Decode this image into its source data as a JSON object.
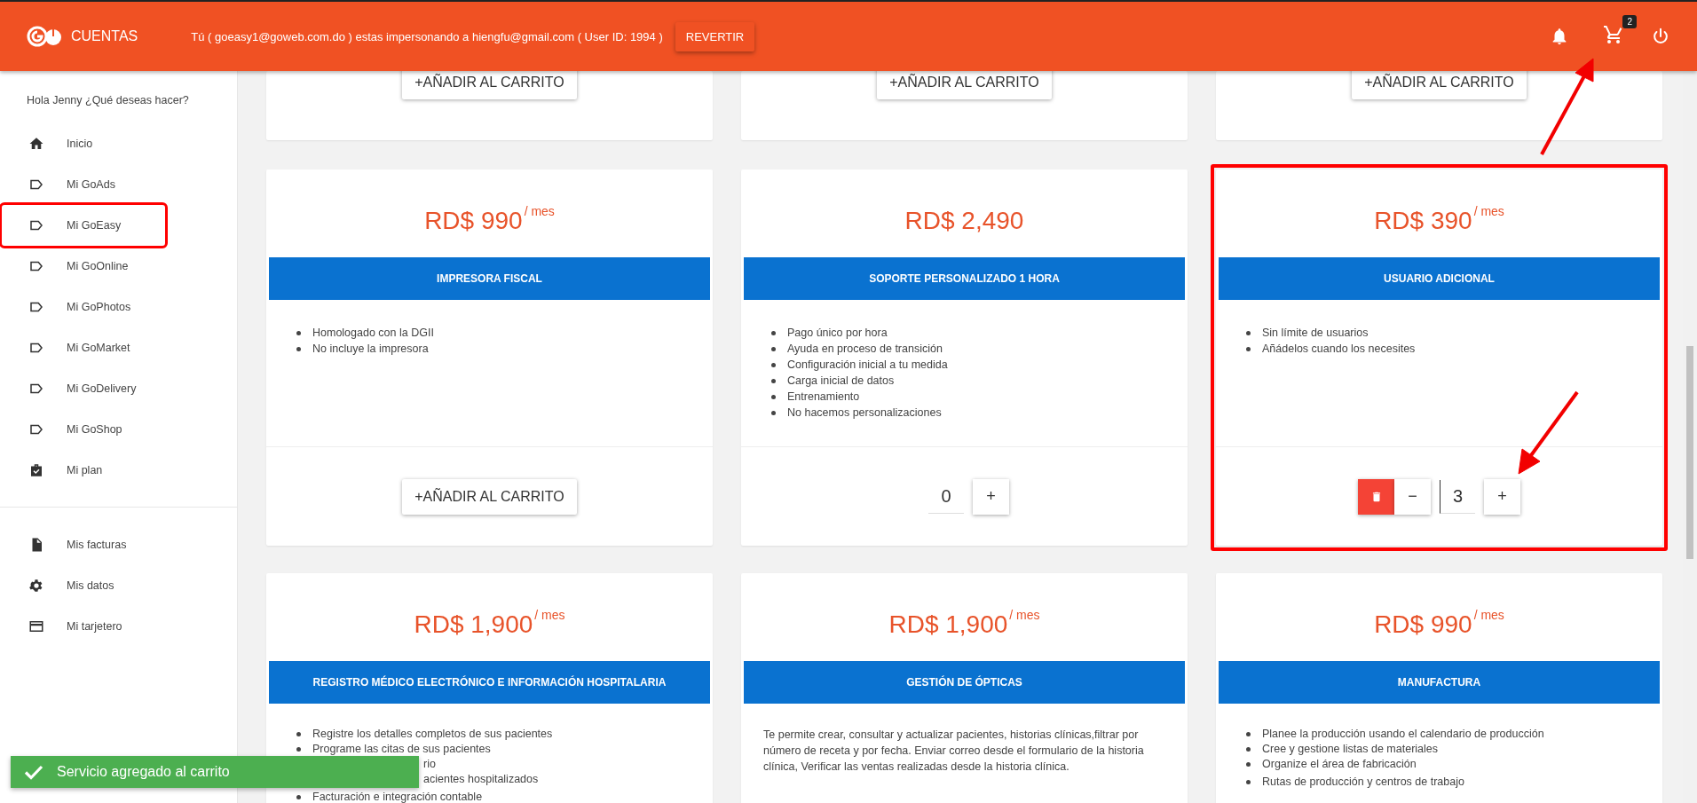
{
  "header": {
    "brand": "CUENTAS",
    "impersonation": "Tú ( goeasy1@goweb.com.do ) estas impersonando a hiengfu@gmail.com ( User ID: 1994 )",
    "revert_button": "REVERTIR",
    "cart_count": "2"
  },
  "sidebar": {
    "greeting": "Hola Jenny ¿Qué deseas hacer?",
    "groups": [
      [
        {
          "label": "Inicio",
          "highlighted": false
        },
        {
          "label": "Mi GoAds",
          "highlighted": false
        },
        {
          "label": "Mi GoEasy",
          "highlighted": true
        },
        {
          "label": "Mi GoOnline",
          "highlighted": false
        },
        {
          "label": "Mi GoPhotos",
          "highlighted": false
        },
        {
          "label": "Mi GoMarket",
          "highlighted": false
        },
        {
          "label": "Mi GoDelivery",
          "highlighted": false
        },
        {
          "label": "Mi GoShop",
          "highlighted": false
        },
        {
          "label": "Mi plan",
          "highlighted": false
        }
      ],
      [
        {
          "label": "Mis facturas",
          "highlighted": false
        },
        {
          "label": "Mis datos",
          "highlighted": false
        },
        {
          "label": "Mi tarjetero",
          "highlighted": false
        }
      ]
    ]
  },
  "top_row": [
    {
      "button": "+AÑADIR AL CARRITO"
    },
    {
      "button": "+AÑADIR AL CARRITO"
    },
    {
      "button": "+AÑADIR AL CARRITO"
    }
  ],
  "cards": [
    {
      "price": "RD$ 990",
      "period": "/ mes",
      "title": "IMPRESORA FISCAL",
      "highlighted": false,
      "features": [
        {
          "kind": "bullet",
          "text": "Homologado con la DGII"
        },
        {
          "kind": "bullet",
          "text": "No incluye la impresora"
        }
      ],
      "footer": {
        "kind": "add",
        "button": "+AÑADIR AL CARRITO"
      }
    },
    {
      "price": "RD$ 2,490",
      "title": "SOPORTE PERSONALIZADO 1 HORA",
      "highlighted": false,
      "features": [
        {
          "kind": "bullet",
          "text": "Pago único por hora"
        },
        {
          "kind": "bullet",
          "text": "Ayuda en proceso de transición"
        },
        {
          "kind": "bullet",
          "text": "Configuración inicial a tu medida"
        },
        {
          "kind": "bullet",
          "text": "Carga inicial de datos"
        },
        {
          "kind": "bullet",
          "text": "Entrenamiento"
        },
        {
          "kind": "bullet",
          "text": "No hacemos personalizaciones"
        }
      ],
      "footer": {
        "kind": "counter",
        "removable": false,
        "quantity": "0",
        "plus": "+"
      }
    },
    {
      "price": "RD$ 390",
      "period": "/ mes",
      "title": "USUARIO ADICIONAL",
      "highlighted": true,
      "features": [
        {
          "kind": "bullet",
          "text": "Sin límite de usuarios"
        },
        {
          "kind": "bullet",
          "text": "Añádelos cuando los necesites"
        }
      ],
      "footer": {
        "kind": "counter",
        "removable": true,
        "minus": "−",
        "quantity": "3",
        "plus": "+"
      }
    },
    {
      "price": "RD$ 1,900",
      "period": "/ mes",
      "title": "REGISTRO MÉDICO ELECTRÓNICO E INFORMACIÓN HOSPITALARIA",
      "highlighted": false,
      "features": [
        {
          "kind": "bullet",
          "text": "Registre los detalles completos de sus pacientes"
        },
        {
          "kind": "bullet",
          "text": "Programe las citas de sus pacientes"
        },
        {
          "kind": "fragment",
          "text": "rio"
        },
        {
          "kind": "fragment",
          "text": "acientes hospitalizados"
        },
        {
          "kind": "bullet",
          "text": "Facturación e integración contable"
        }
      ]
    },
    {
      "price": "RD$ 1,900",
      "period": "/ mes",
      "title": "GESTIÓN DE ÓPTICAS",
      "highlighted": false,
      "description": "Te permite crear, consultar y actualizar pacientes, historias clínicas,filtrar por número de receta y por fecha. Enviar correo desde el formulario de la historia clínica, Verificar las ventas realizadas desde la historia clínica."
    },
    {
      "price": "RD$ 990",
      "period": "/ mes",
      "title": "MANUFACTURA",
      "highlighted": false,
      "features": [
        {
          "kind": "bullet",
          "text": "Planee la producción usando el calendario de producción"
        },
        {
          "kind": "bullet",
          "text": "Cree y gestione listas de materiales"
        },
        {
          "kind": "bullet",
          "text": "Organize el área de fabricación"
        },
        {
          "kind": "bullet",
          "text": "Rutas de producción y centros de trabajo"
        }
      ]
    }
  ],
  "toast": "Servicio agregado al carrito"
}
